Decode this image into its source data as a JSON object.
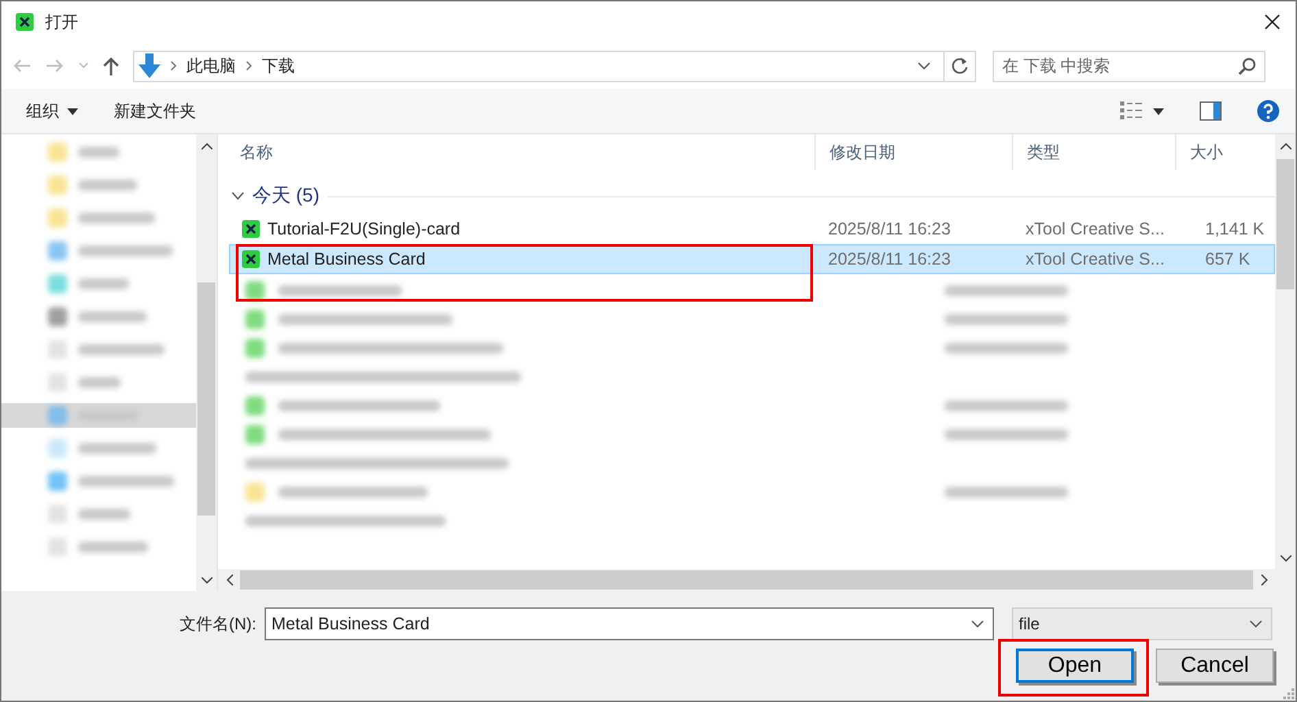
{
  "window": {
    "title": "打开"
  },
  "address": {
    "path": [
      "此电脑",
      "下载"
    ]
  },
  "search": {
    "placeholder": "在 下载 中搜索"
  },
  "toolbar": {
    "organize": "组织",
    "new_folder": "新建文件夹"
  },
  "columns": [
    "名称",
    "修改日期",
    "类型",
    "大小"
  ],
  "groups": [
    {
      "label": "今天 (5)",
      "expanded": true,
      "files": [
        {
          "name": "Tutorial-F2U(Single)-card",
          "date": "2025/8/11 16:23",
          "type": "xTool Creative S...",
          "size": "1,141 K",
          "selected": false
        },
        {
          "name": "Metal Business Card",
          "date": "2025/8/11 16:23",
          "type": "xTool Creative S...",
          "size": "657 K",
          "selected": true
        }
      ]
    }
  ],
  "filename": {
    "label": "文件名(N):",
    "value": "Metal Business Card"
  },
  "filetype": {
    "value": "file"
  },
  "buttons": [
    {
      "label": "Open",
      "kind": "default"
    },
    {
      "label": "Cancel",
      "kind": "normal"
    }
  ]
}
